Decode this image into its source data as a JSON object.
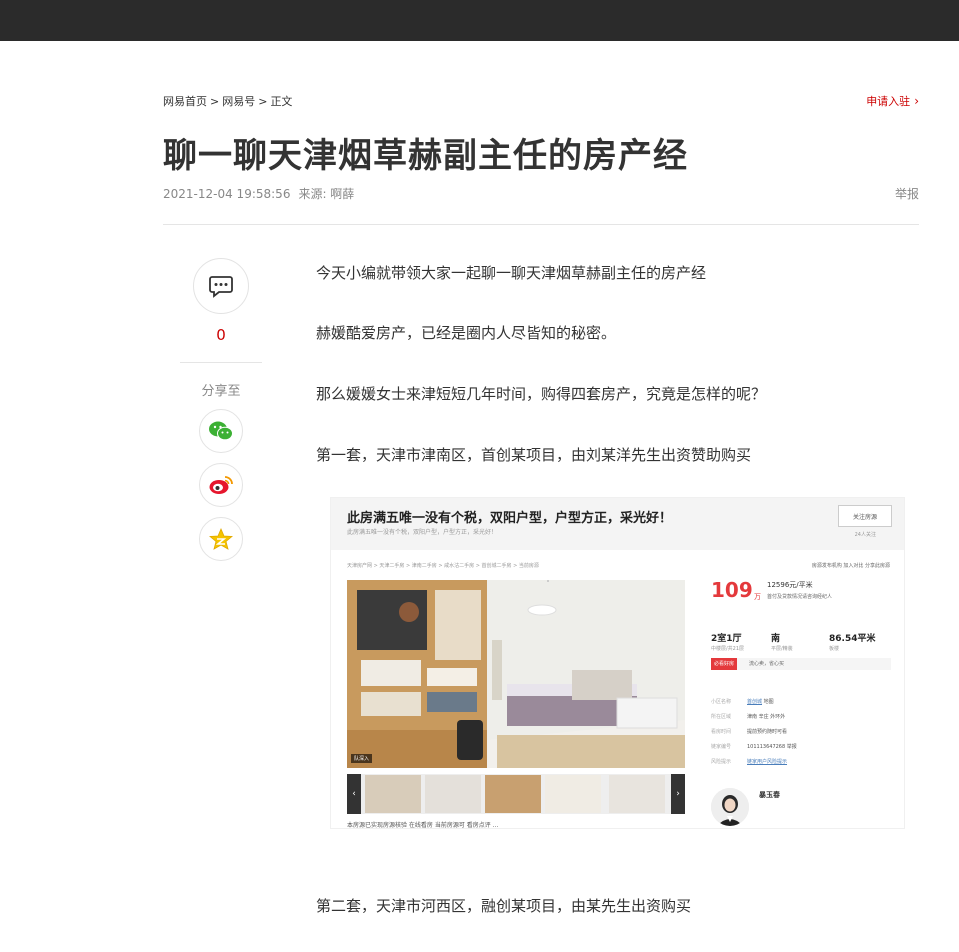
{
  "breadcrumb": {
    "home": "网易首页",
    "sep": ">",
    "netease_hao": "网易号",
    "current": "正文"
  },
  "apply_link": {
    "label": "申请入驻",
    "chevron": "›"
  },
  "article": {
    "title": "聊一聊天津烟草赫副主任的房产经",
    "datetime": "2021-12-04 19:58:56",
    "source": "来源: 啊薛",
    "report_label": "举报",
    "paragraphs": [
      "今天小编就带领大家一起聊一聊天津烟草赫副主任的房产经",
      "赫媛酷爱房产，已经是圈内人尽皆知的秘密。",
      "那么媛媛女士来津短短几年时间，购得四套房产，究竟是怎样的呢？",
      "第一套，天津市津南区，首创某项目，由刘某洋先生出资赞助购买",
      "第二套，天津市河西区，融创某项目，由某先生出资购买"
    ]
  },
  "sidebar": {
    "comment_icon": "comment-icon",
    "comment_count": "0",
    "share_label": "分享至",
    "share_icons": [
      "wechat-icon",
      "weibo-icon",
      "qzone-icon"
    ]
  },
  "listing_screenshot": {
    "headline": "此房满五唯一没有个税，双阳户型，户型方正，采光好！",
    "subline": "此房满五唯一没有个税，双阳户型，户型方正，采光好！",
    "follow_button": "关注房源",
    "followers": "24人关注",
    "subnav": "天津房产网 > 天津二手房 > 津南二手房 > 咸水沽二手房 > 首创城二手房 > 当前房源",
    "tools": "房源发布机构   加入对比   分享此房源",
    "vr_badge": "队深入",
    "price": "109",
    "price_unit": "万",
    "unit_price": "12596元/平米",
    "unit_price_note": "首付及贷款情况请咨询经纪人",
    "specs": [
      {
        "value": "2室1厅",
        "sub": "中楼层/共21层"
      },
      {
        "value": "南",
        "sub": "平层/精装"
      },
      {
        "value": "86.54平米",
        "sub": "板楼"
      }
    ],
    "tag": "必看好房",
    "tag_text": "流心卖，省心买",
    "info_rows": [
      {
        "k": "小区名称",
        "v": "首创城",
        "extra": "地图"
      },
      {
        "k": "所在区域",
        "v": "津南 辛庄 外环外",
        "extra": ""
      },
      {
        "k": "看房时间",
        "v": "提前预约随时可看",
        "extra": ""
      },
      {
        "k": "链家编号",
        "v": "101113647268",
        "extra": "举报"
      },
      {
        "k": "风险提示",
        "v": "链家用户风险提示",
        "extra": ""
      }
    ],
    "agent_name": "暴玉春",
    "footer_text": "本房源已实现房源核验   在线看房   当前房源可   看房点评    ..."
  },
  "colors": {
    "topbar": "#2b2b2b",
    "accent_red": "#cc0000",
    "price_red": "#e4393c"
  }
}
